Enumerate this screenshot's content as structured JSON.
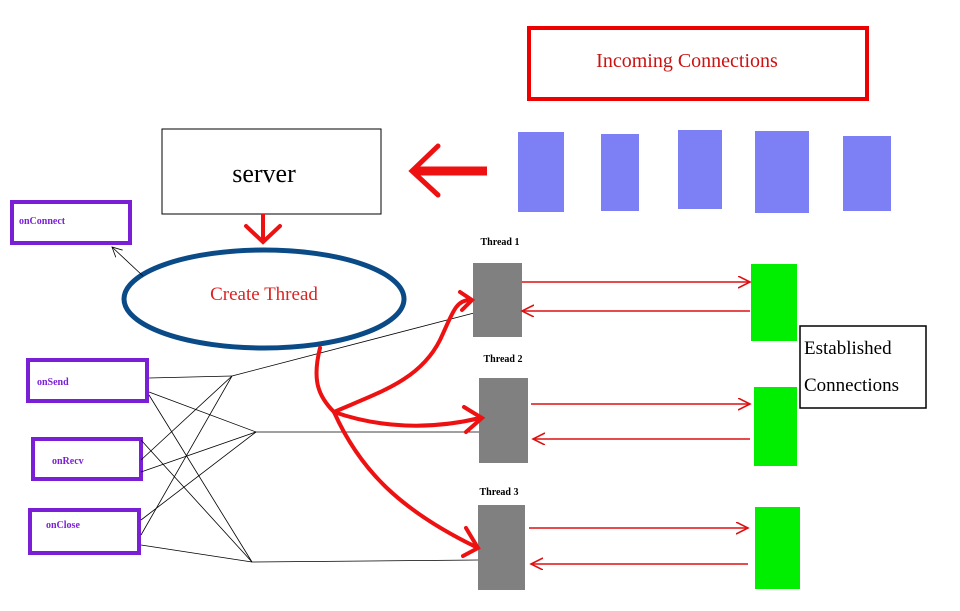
{
  "incoming": {
    "title": "Incoming Connections",
    "connection_count": 5,
    "color": "#7d7ff5",
    "border_color": "#ee0000",
    "text_color": "#cc1111"
  },
  "server": {
    "label": "server"
  },
  "create_thread": {
    "label": "Create Thread",
    "ellipse_color": "#0a4a86",
    "text_color": "#dd2222"
  },
  "callbacks": {
    "color": "#7a1fd6",
    "on_connect": "onConnect",
    "on_send": "onSend",
    "on_recv": "onRecv",
    "on_close": "onClose"
  },
  "threads": [
    {
      "label": "Thread 1"
    },
    {
      "label": "Thread 2"
    },
    {
      "label": "Thread 3"
    }
  ],
  "thread_color": "#808080",
  "established": {
    "line1": "Established",
    "line2": "Connections",
    "color": "#00ee00"
  },
  "arrow_color": "#ee1111"
}
